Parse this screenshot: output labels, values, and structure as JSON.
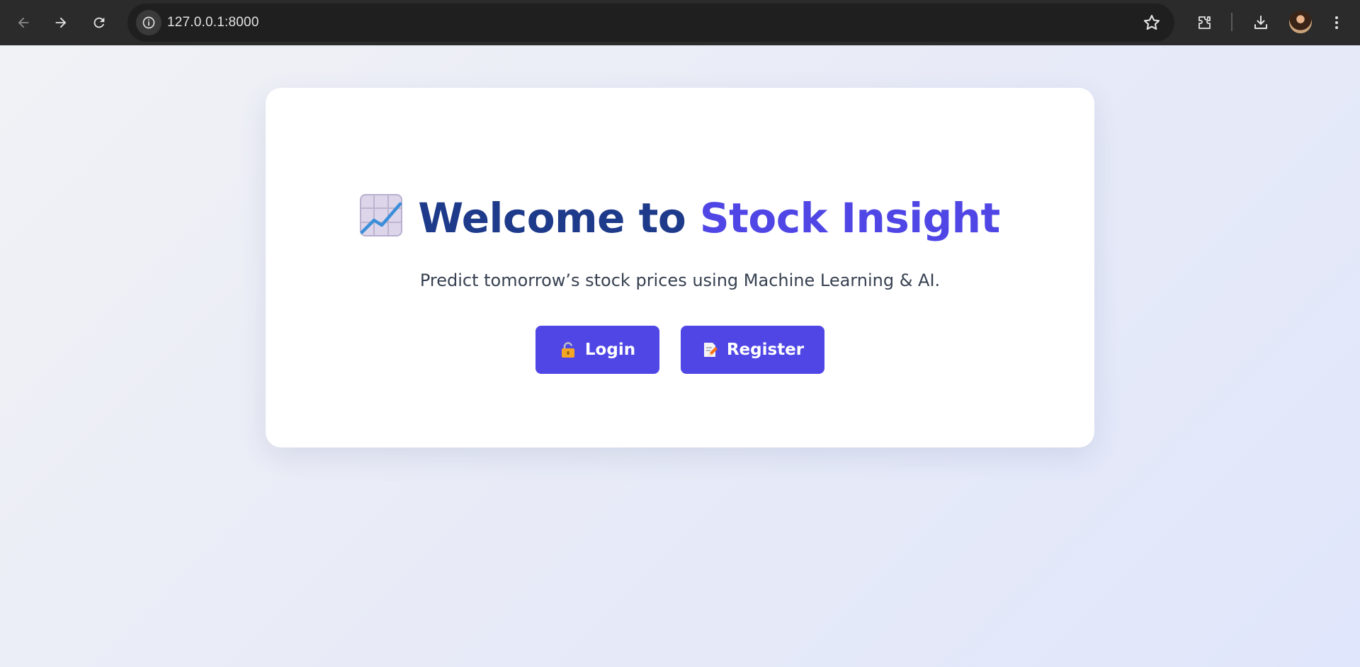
{
  "browser": {
    "url": "127.0.0.1:8000",
    "icons": [
      "back-arrow-icon",
      "forward-arrow-icon",
      "reload-icon",
      "site-info-icon",
      "bookmark-star-icon",
      "extensions-icon",
      "downloads-icon",
      "profile-avatar",
      "more-menu-icon"
    ]
  },
  "hero": {
    "title_prefix": "Welcome to ",
    "title_accent": "Stock Insight",
    "emoji": "chart-increasing-icon",
    "subtitle": "Predict tomorrow’s stock prices using Machine Learning & AI."
  },
  "actions": {
    "login_label": "Login",
    "login_icon": "padlock-icon",
    "register_label": "Register",
    "register_icon": "memo-icon"
  },
  "colors": {
    "title": "#1e3a8a",
    "accent": "#4f46e5",
    "button_bg": "#4f46e5",
    "subtitle": "#374151"
  }
}
